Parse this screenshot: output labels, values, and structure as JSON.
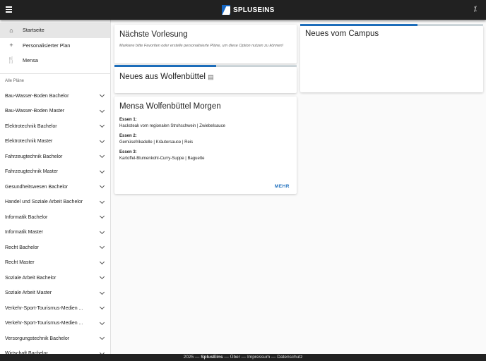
{
  "header": {
    "logo_text": "SPLUSEINS"
  },
  "nav": [
    {
      "icon": "home-icon",
      "glyph": "⌂",
      "label": "Startseite",
      "active": true
    },
    {
      "icon": "plus-icon",
      "glyph": "+",
      "label": "Personalisierter Plan"
    },
    {
      "icon": "restaurant-icon",
      "glyph": "🍴",
      "label": "Mensa"
    }
  ],
  "sidebar": {
    "section_label": "Alle Pläne",
    "plans": [
      "Bau-Wasser-Boden Bachelor",
      "Bau-Wasser-Boden Master",
      "Elektrotechnik Bachelor",
      "Elektrotechnik Master",
      "Fahrzeugtechnik Bachelor",
      "Fahrzeugtechnik Master",
      "Gesundheitswesen Bachelor",
      "Handel und Soziale Arbeit Bachelor",
      "Informatik Bachelor",
      "Informatik Master",
      "Recht Bachelor",
      "Recht Master",
      "Soziale Arbeit Bachelor",
      "Soziale Arbeit Master",
      "Verkehr-Sport-Tourismus-Medien ...",
      "Verkehr-Sport-Tourismus-Medien ...",
      "Versorgungstechnik Bachelor",
      "Wirtschaft Bachelor"
    ]
  },
  "cards": {
    "next": {
      "title": "Nächste Vorlesung",
      "hint": "Markiere bitte Favoriten oder erstelle personalisierte Pläne, um diese Option nutzen zu können!"
    },
    "wf_news": {
      "title": "Neues aus Wolfenbüttel",
      "progress": 0.56
    },
    "campus": {
      "title": "Neues vom Campus",
      "progress": 0.64
    },
    "mensa": {
      "title": "Mensa Wolfenbüttel Morgen",
      "meals": [
        {
          "label": "Essen 1:",
          "text": "Hacksteak vom regionalen Strohschwein | Zwiebelsauce"
        },
        {
          "label": "Essen 2:",
          "text": "Gemüsefrikadelle | Kräutersauce | Reis"
        },
        {
          "label": "Essen 3:",
          "text": "Kartoffel-Blumenkohl-Curry-Suppe | Baguette"
        }
      ],
      "more": "MEHR"
    }
  },
  "footer": {
    "year": "2025",
    "brand": "SplusEins",
    "links": [
      "Über",
      "Impressum",
      "Datenschutz"
    ]
  }
}
